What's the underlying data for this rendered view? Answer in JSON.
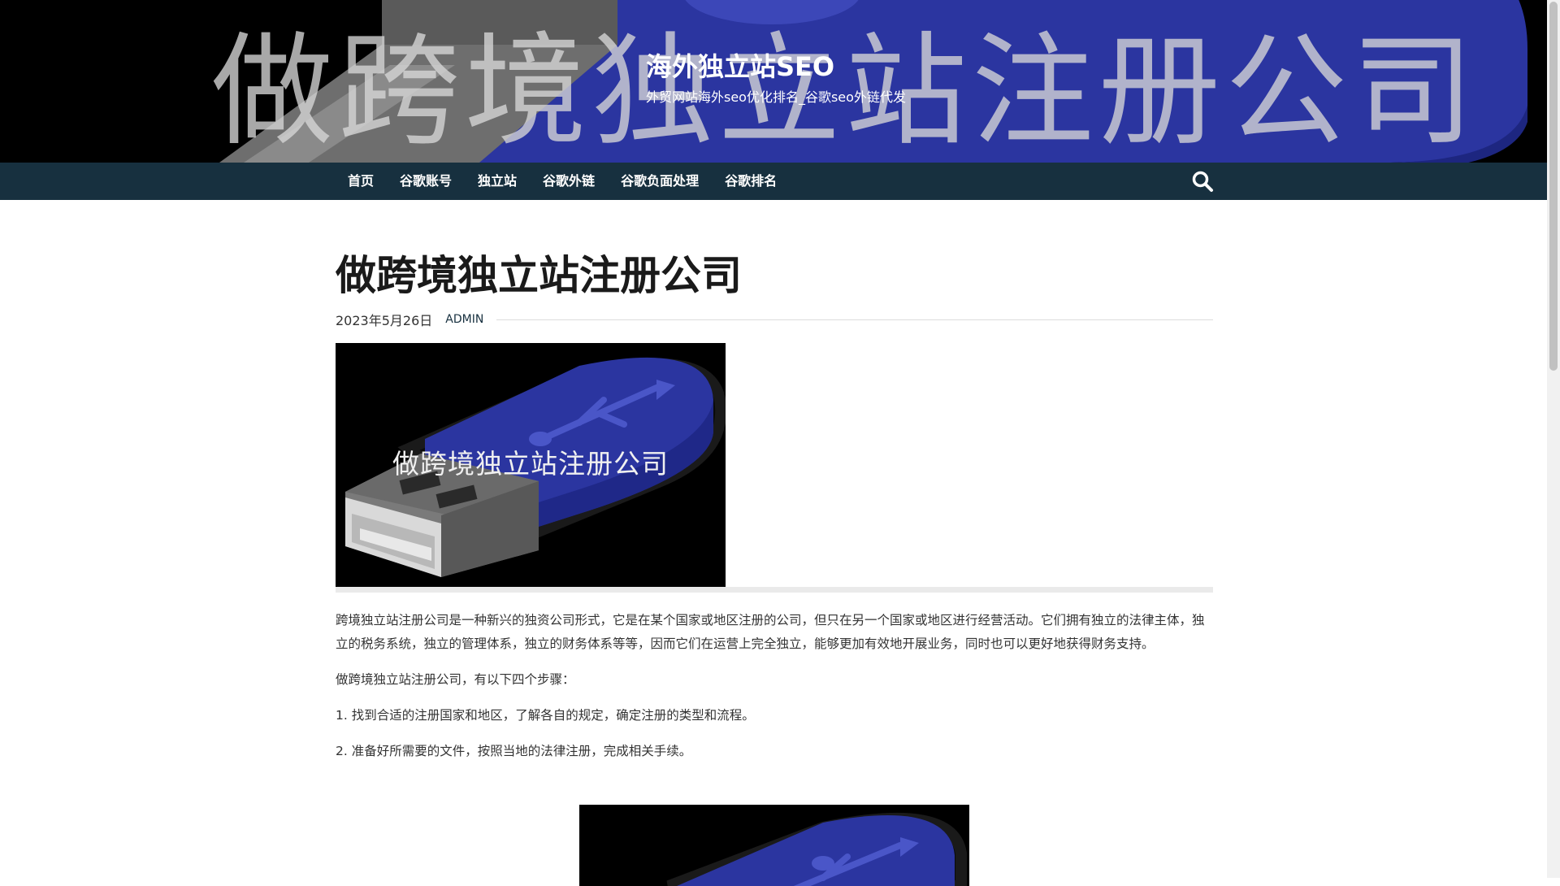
{
  "site": {
    "title": "海外独立站SEO",
    "description": "外贸网站海外seo优化排名_谷歌seo外链代发",
    "banner_watermark": "做跨境独立站注册公司"
  },
  "nav": {
    "items": [
      {
        "label": "首页"
      },
      {
        "label": "谷歌账号"
      },
      {
        "label": "独立站"
      },
      {
        "label": "谷歌外链"
      },
      {
        "label": "谷歌负面处理"
      },
      {
        "label": "谷歌排名"
      }
    ],
    "search_icon": "search-icon"
  },
  "article": {
    "title": "做跨境独立站注册公司",
    "date": "2023年5月26日",
    "author": "ADMIN",
    "featured_caption": "做跨境独立站注册公司",
    "paragraphs": [
      "跨境独立站注册公司是一种新兴的独资公司形式，它是在某个国家或地区注册的公司，但只在另一个国家或地区进行经营活动。它们拥有独立的法律主体，独立的税务系统，独立的管理体系，独立的财务体系等等，因而它们在运营上完全独立，能够更加有效地开展业务，同时也可以更好地获得财务支持。",
      "做跨境独立站注册公司，有以下四个步骤：",
      "1. 找到合适的注册国家和地区，了解各自的规定，确定注册的类型和流程。",
      "2. 准备好所需要的文件，按照当地的法律注册，完成相关手续。"
    ]
  },
  "colors": {
    "nav_bg": "#17303f",
    "usb_blue": "#2b35a0",
    "author_link": "#17303f"
  }
}
